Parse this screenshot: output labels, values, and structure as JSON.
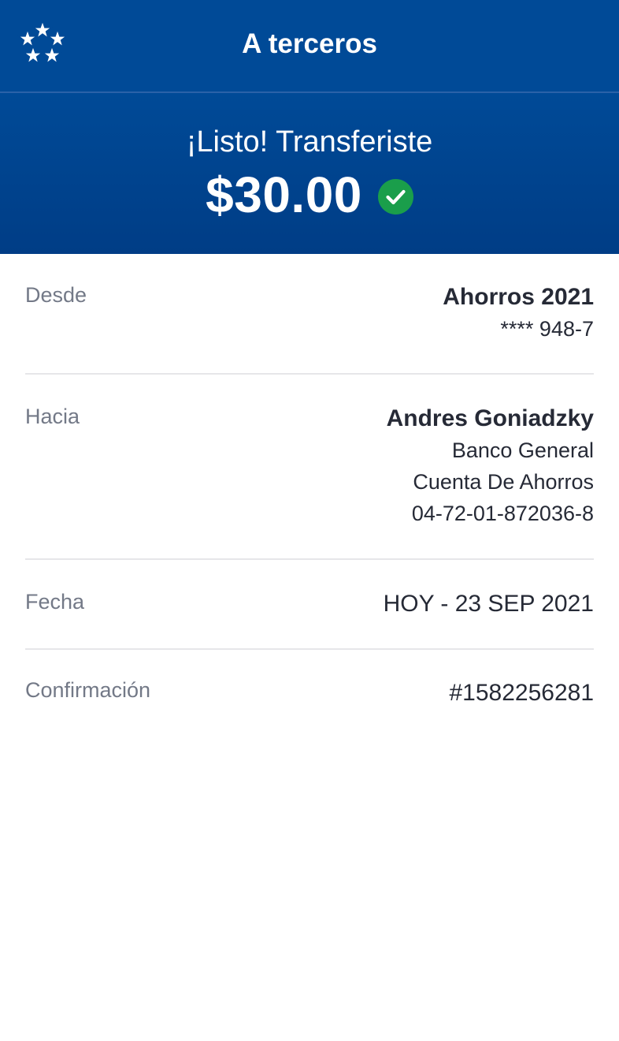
{
  "header": {
    "title": "A terceros",
    "logo_icon": "stars-logo-icon"
  },
  "hero": {
    "subtitle": "¡Listo! Transferiste",
    "amount": "$30.00",
    "status_icon": "check-circle-icon",
    "status_color": "#1a9e4b"
  },
  "details": {
    "from": {
      "label": "Desde",
      "account_name": "Ahorros 2021",
      "account_number": "**** 948-7"
    },
    "to": {
      "label": "Hacia",
      "name": "Andres Goniadzky",
      "bank": "Banco General",
      "account_type": "Cuenta De Ahorros",
      "account_number": "04-72-01-872036-8"
    },
    "date": {
      "label": "Fecha",
      "value": "HOY - 23 SEP 2021"
    },
    "confirmation": {
      "label": "Confirmación",
      "value": "#1582256281"
    }
  },
  "colors": {
    "header_bg": "#004a97",
    "text_dark": "#262a36",
    "label_gray": "#737987",
    "divider": "#e6e6e9"
  }
}
